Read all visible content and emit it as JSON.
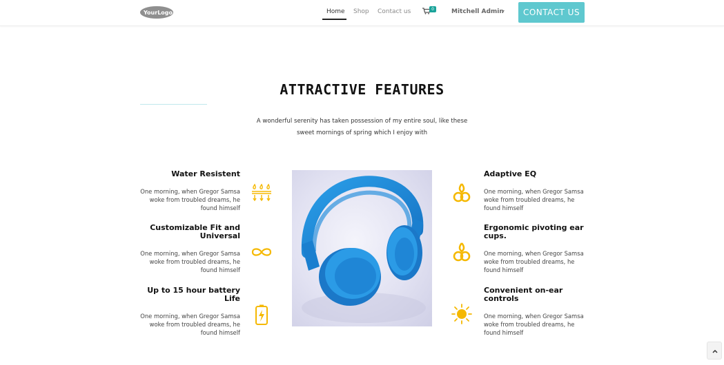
{
  "header": {
    "logo_text": "YourLogo",
    "nav": {
      "home": "Home",
      "shop": "Shop",
      "contact": "Contact us"
    },
    "cart_count": "0",
    "user_name": "Mitchell Admin",
    "cta_label": "CONTACT US"
  },
  "section": {
    "title": "ATTRACTIVE FEATURES",
    "subtitle_line1": "A wonderful serenity has taken possession of my entire soul, like these",
    "subtitle_line2": "sweet mornings of spring which I enjoy with"
  },
  "features_left": [
    {
      "title": "Water Resistent",
      "desc_lines": [
        "One morning, when Gregor Samsa",
        "woke from troubled dreams, he",
        "found himself"
      ],
      "icon": "water-drops-icon"
    },
    {
      "title_lines": [
        "Customizable Fit and",
        "Universal"
      ],
      "desc_lines": [
        "One morning, when Gregor Samsa",
        "woke from troubled dreams, he",
        "found himself"
      ],
      "icon": "infinity-icon"
    },
    {
      "title_lines": [
        "Up to 15 hour battery",
        "Life"
      ],
      "desc_lines": [
        "One morning, when Gregor Samsa",
        "woke from troubled dreams, he",
        "found himself"
      ],
      "icon": "battery-charging-icon"
    }
  ],
  "features_right": [
    {
      "title": "Adaptive EQ",
      "desc_lines": [
        "One morning, when Gregor Samsa",
        "woke from troubled dreams, he",
        "found himself"
      ],
      "icon": "eq-knot-icon"
    },
    {
      "title_lines": [
        "Ergonomic pivoting ear",
        "cups."
      ],
      "desc_lines": [
        "One morning, when Gregor Samsa",
        "woke from troubled dreams, he",
        "found himself"
      ],
      "icon": "pivot-knot-icon"
    },
    {
      "title_lines": [
        "Convenient on-ear",
        "controls"
      ],
      "desc_lines": [
        "One morning, when Gregor Samsa",
        "woke from troubled dreams, he",
        "found himself"
      ],
      "icon": "sun-controls-icon"
    }
  ],
  "colors": {
    "accent": "#5fc8cf",
    "icon": "#f5b800",
    "headphones": "#1e88d8"
  }
}
